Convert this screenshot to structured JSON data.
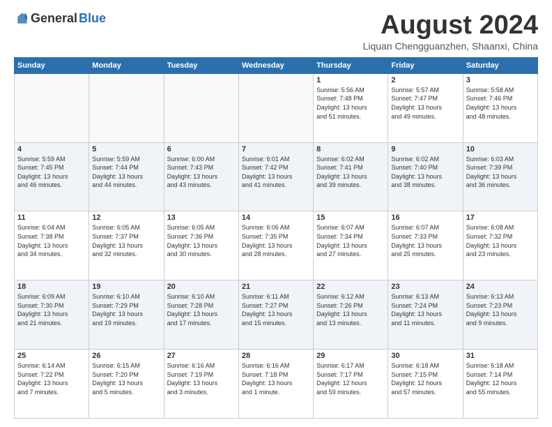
{
  "logo": {
    "general": "General",
    "blue": "Blue"
  },
  "title": {
    "month_year": "August 2024",
    "location": "Liquan Chengguanzhen, Shaanxi, China"
  },
  "headers": [
    "Sunday",
    "Monday",
    "Tuesday",
    "Wednesday",
    "Thursday",
    "Friday",
    "Saturday"
  ],
  "weeks": [
    [
      {
        "num": "",
        "info": ""
      },
      {
        "num": "",
        "info": ""
      },
      {
        "num": "",
        "info": ""
      },
      {
        "num": "",
        "info": ""
      },
      {
        "num": "1",
        "info": "Sunrise: 5:56 AM\nSunset: 7:48 PM\nDaylight: 13 hours\nand 51 minutes."
      },
      {
        "num": "2",
        "info": "Sunrise: 5:57 AM\nSunset: 7:47 PM\nDaylight: 13 hours\nand 49 minutes."
      },
      {
        "num": "3",
        "info": "Sunrise: 5:58 AM\nSunset: 7:46 PM\nDaylight: 13 hours\nand 48 minutes."
      }
    ],
    [
      {
        "num": "4",
        "info": "Sunrise: 5:59 AM\nSunset: 7:45 PM\nDaylight: 13 hours\nand 46 minutes."
      },
      {
        "num": "5",
        "info": "Sunrise: 5:59 AM\nSunset: 7:44 PM\nDaylight: 13 hours\nand 44 minutes."
      },
      {
        "num": "6",
        "info": "Sunrise: 6:00 AM\nSunset: 7:43 PM\nDaylight: 13 hours\nand 43 minutes."
      },
      {
        "num": "7",
        "info": "Sunrise: 6:01 AM\nSunset: 7:42 PM\nDaylight: 13 hours\nand 41 minutes."
      },
      {
        "num": "8",
        "info": "Sunrise: 6:02 AM\nSunset: 7:41 PM\nDaylight: 13 hours\nand 39 minutes."
      },
      {
        "num": "9",
        "info": "Sunrise: 6:02 AM\nSunset: 7:40 PM\nDaylight: 13 hours\nand 38 minutes."
      },
      {
        "num": "10",
        "info": "Sunrise: 6:03 AM\nSunset: 7:39 PM\nDaylight: 13 hours\nand 36 minutes."
      }
    ],
    [
      {
        "num": "11",
        "info": "Sunrise: 6:04 AM\nSunset: 7:38 PM\nDaylight: 13 hours\nand 34 minutes."
      },
      {
        "num": "12",
        "info": "Sunrise: 6:05 AM\nSunset: 7:37 PM\nDaylight: 13 hours\nand 32 minutes."
      },
      {
        "num": "13",
        "info": "Sunrise: 6:05 AM\nSunset: 7:36 PM\nDaylight: 13 hours\nand 30 minutes."
      },
      {
        "num": "14",
        "info": "Sunrise: 6:06 AM\nSunset: 7:35 PM\nDaylight: 13 hours\nand 28 minutes."
      },
      {
        "num": "15",
        "info": "Sunrise: 6:07 AM\nSunset: 7:34 PM\nDaylight: 13 hours\nand 27 minutes."
      },
      {
        "num": "16",
        "info": "Sunrise: 6:07 AM\nSunset: 7:33 PM\nDaylight: 13 hours\nand 25 minutes."
      },
      {
        "num": "17",
        "info": "Sunrise: 6:08 AM\nSunset: 7:32 PM\nDaylight: 13 hours\nand 23 minutes."
      }
    ],
    [
      {
        "num": "18",
        "info": "Sunrise: 6:09 AM\nSunset: 7:30 PM\nDaylight: 13 hours\nand 21 minutes."
      },
      {
        "num": "19",
        "info": "Sunrise: 6:10 AM\nSunset: 7:29 PM\nDaylight: 13 hours\nand 19 minutes."
      },
      {
        "num": "20",
        "info": "Sunrise: 6:10 AM\nSunset: 7:28 PM\nDaylight: 13 hours\nand 17 minutes."
      },
      {
        "num": "21",
        "info": "Sunrise: 6:11 AM\nSunset: 7:27 PM\nDaylight: 13 hours\nand 15 minutes."
      },
      {
        "num": "22",
        "info": "Sunrise: 6:12 AM\nSunset: 7:26 PM\nDaylight: 13 hours\nand 13 minutes."
      },
      {
        "num": "23",
        "info": "Sunrise: 6:13 AM\nSunset: 7:24 PM\nDaylight: 13 hours\nand 11 minutes."
      },
      {
        "num": "24",
        "info": "Sunrise: 6:13 AM\nSunset: 7:23 PM\nDaylight: 13 hours\nand 9 minutes."
      }
    ],
    [
      {
        "num": "25",
        "info": "Sunrise: 6:14 AM\nSunset: 7:22 PM\nDaylight: 13 hours\nand 7 minutes."
      },
      {
        "num": "26",
        "info": "Sunrise: 6:15 AM\nSunset: 7:20 PM\nDaylight: 13 hours\nand 5 minutes."
      },
      {
        "num": "27",
        "info": "Sunrise: 6:16 AM\nSunset: 7:19 PM\nDaylight: 13 hours\nand 3 minutes."
      },
      {
        "num": "28",
        "info": "Sunrise: 6:16 AM\nSunset: 7:18 PM\nDaylight: 13 hours\nand 1 minute."
      },
      {
        "num": "29",
        "info": "Sunrise: 6:17 AM\nSunset: 7:17 PM\nDaylight: 12 hours\nand 59 minutes."
      },
      {
        "num": "30",
        "info": "Sunrise: 6:18 AM\nSunset: 7:15 PM\nDaylight: 12 hours\nand 57 minutes."
      },
      {
        "num": "31",
        "info": "Sunrise: 6:18 AM\nSunset: 7:14 PM\nDaylight: 12 hours\nand 55 minutes."
      }
    ]
  ]
}
